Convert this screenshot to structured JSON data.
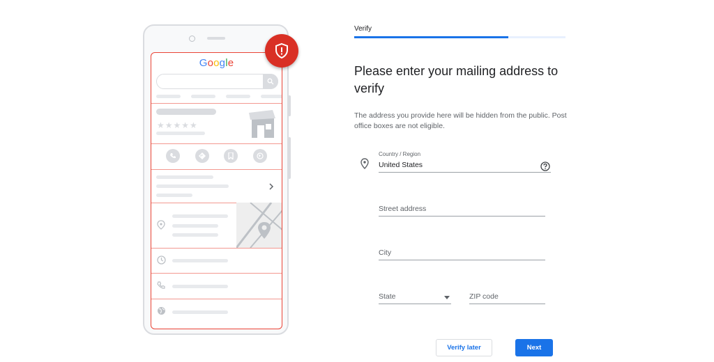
{
  "illustration": {
    "logo_letters": [
      "G",
      "o",
      "o",
      "g",
      "l",
      "e"
    ],
    "rating_stars": "★★★★★",
    "icons": [
      "shield-alert-icon",
      "search-icon",
      "phone-icon",
      "directions-icon",
      "bookmark-icon",
      "website-icon",
      "chevron-right-icon",
      "location-pin-icon",
      "clock-icon",
      "phone-icon",
      "globe-icon"
    ]
  },
  "stepper": {
    "label": "Verify",
    "progress": 0.73
  },
  "form": {
    "heading": "Please enter your mailing address to verify",
    "description": "The address you provide here will be hidden from the public. Post office boxes are not eligible.",
    "country_label": "Country / Region",
    "country_value": "United States",
    "street_placeholder": "Street address",
    "city_placeholder": "City",
    "state_placeholder": "State",
    "zip_placeholder": "ZIP code"
  },
  "buttons": {
    "verify_later": "Verify later",
    "next": "Next"
  },
  "colors": {
    "accent": "#1a73e8",
    "alert": "#d93025"
  }
}
